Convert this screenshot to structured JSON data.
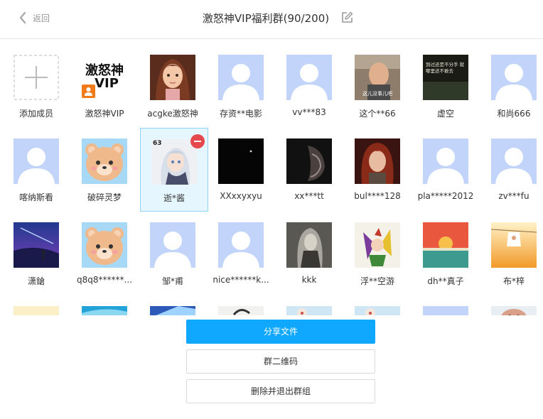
{
  "header": {
    "back_label": "返回",
    "title": "激怒神VIP福利群(90/200)"
  },
  "members": [
    {
      "name": "添加成员",
      "avatar": "add-member-icon"
    },
    {
      "name": "激怒神VIP",
      "avatar": "vip-text",
      "avatar_text": "激怒神 VIP"
    },
    {
      "name": "acgke激怒神",
      "avatar": "anime-girl"
    },
    {
      "name": "存资**电影",
      "avatar": "default"
    },
    {
      "name": "vv***83",
      "avatar": "default"
    },
    {
      "name": "这个**66",
      "avatar": "photo-man",
      "avatar_text": "这儿没事儿吧"
    },
    {
      "name": "虚空",
      "avatar": "photo-text",
      "avatar_text": "到过还是不分手 就哪里还不敢去"
    },
    {
      "name": "和尚666",
      "avatar": "default"
    },
    {
      "name": "喀纳斯看",
      "avatar": "default"
    },
    {
      "name": "破碎灵梦",
      "avatar": "bear"
    },
    {
      "name": "逝*酱",
      "avatar": "anime-white-hair",
      "avatar_text": "63",
      "selected": true
    },
    {
      "name": "XXxxyxyu",
      "avatar": "dark"
    },
    {
      "name": "xx***tt",
      "avatar": "dark-face"
    },
    {
      "name": "bul****128",
      "avatar": "red-hair"
    },
    {
      "name": "pla*****2012",
      "avatar": "default"
    },
    {
      "name": "zv***fu",
      "avatar": "default"
    },
    {
      "name": "潇鎗",
      "avatar": "night-sky"
    },
    {
      "name": "q8q8******...",
      "avatar": "bear"
    },
    {
      "name": "邹*甫",
      "avatar": "default"
    },
    {
      "name": "nice******k...",
      "avatar": "default"
    },
    {
      "name": "kkk",
      "avatar": "grey-anime"
    },
    {
      "name": "浮**空游",
      "avatar": "colorful-anime"
    },
    {
      "name": "dh**真子",
      "avatar": "sunset"
    },
    {
      "name": "布*梓",
      "avatar": "orange-field"
    },
    {
      "name": "",
      "avatar": "cream"
    },
    {
      "name": "",
      "avatar": "blue-glow"
    },
    {
      "name": "",
      "avatar": "blue-light"
    },
    {
      "name": "",
      "avatar": "sketch"
    },
    {
      "name": "",
      "avatar": "cartoon-light"
    },
    {
      "name": "",
      "avatar": "cartoon-light"
    },
    {
      "name": "",
      "avatar": "default"
    },
    {
      "name": "",
      "avatar": "cartoon-brown"
    }
  ],
  "actions": {
    "share": "分享文件",
    "qrcode": "群二维码",
    "quit": "删除并退出群组"
  },
  "colors": {
    "primary": "#10a8ff",
    "selected_bg": "#e6f6ff",
    "selected_border": "#8fd3f7",
    "remove_badge": "#e5484d",
    "default_avatar": "#c3d4fb"
  }
}
